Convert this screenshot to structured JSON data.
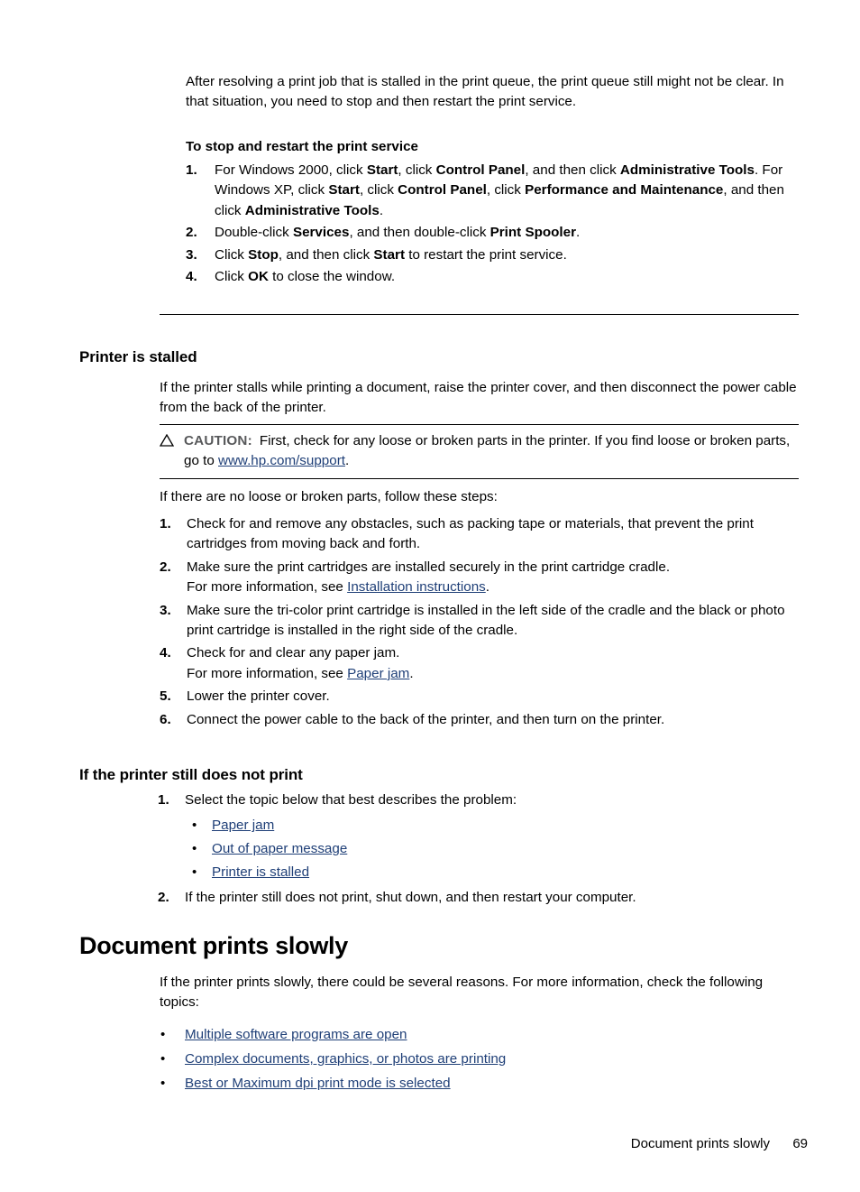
{
  "document": {
    "intro_paragraph": "After resolving a print job that is stalled in the print queue, the print queue still might not be clear. In that situation, you need to stop and then restart the print service.",
    "restart_service": {
      "heading": "To stop and restart the print service",
      "steps": [
        {
          "number": "1.",
          "segments": [
            {
              "text": "For Windows 2000, click ",
              "bold": false
            },
            {
              "text": "Start",
              "bold": true
            },
            {
              "text": ", click ",
              "bold": false
            },
            {
              "text": "Control Panel",
              "bold": true
            },
            {
              "text": ", and then click ",
              "bold": false
            },
            {
              "text": "Administrative Tools",
              "bold": true
            },
            {
              "text": ". For Windows XP, click ",
              "bold": false
            },
            {
              "text": "Start",
              "bold": true
            },
            {
              "text": ", click ",
              "bold": false
            },
            {
              "text": "Control Panel",
              "bold": true
            },
            {
              "text": ", click ",
              "bold": false
            },
            {
              "text": "Performance and Maintenance",
              "bold": true
            },
            {
              "text": ", and then click ",
              "bold": false
            },
            {
              "text": "Administrative Tools",
              "bold": true
            },
            {
              "text": ".",
              "bold": false
            }
          ]
        },
        {
          "number": "2.",
          "segments": [
            {
              "text": "Double-click ",
              "bold": false
            },
            {
              "text": "Services",
              "bold": true
            },
            {
              "text": ", and then double-click ",
              "bold": false
            },
            {
              "text": "Print Spooler",
              "bold": true
            },
            {
              "text": ".",
              "bold": false
            }
          ]
        },
        {
          "number": "3.",
          "segments": [
            {
              "text": "Click ",
              "bold": false
            },
            {
              "text": "Stop",
              "bold": true
            },
            {
              "text": ", and then click ",
              "bold": false
            },
            {
              "text": "Start",
              "bold": true
            },
            {
              "text": " to restart the print service.",
              "bold": false
            }
          ]
        },
        {
          "number": "4.",
          "segments": [
            {
              "text": "Click ",
              "bold": false
            },
            {
              "text": "OK",
              "bold": true
            },
            {
              "text": " to close the window.",
              "bold": false
            }
          ]
        }
      ]
    },
    "printer_stalled": {
      "heading": "Printer is stalled",
      "paragraph": "If the printer stalls while printing a document, raise the printer cover, and then disconnect the power cable from the back of the printer.",
      "caution": {
        "icon": "warning-triangle-icon",
        "label": "CAUTION:",
        "text_before_link": "First, check for any loose or broken parts in the printer. If you find loose or broken parts, go to ",
        "link_text": "www.hp.com/support",
        "text_after_link": "."
      },
      "steps_intro": "If there are no loose or broken parts, follow these steps:",
      "steps": [
        {
          "number": "1.",
          "segments": [
            {
              "text": "Check for and remove any obstacles, such as packing tape or materials, that prevent the print cartridges from moving back and forth.",
              "bold": false
            }
          ]
        },
        {
          "number": "2.",
          "segments": [
            {
              "text": "Make sure the print cartridges are installed securely in the print cartridge cradle.",
              "bold": false
            },
            {
              "text": "\n",
              "linebreak": true
            },
            {
              "text": "For more information, see ",
              "bold": false
            },
            {
              "text": "Installation instructions",
              "link": true
            },
            {
              "text": ".",
              "bold": false
            }
          ]
        },
        {
          "number": "3.",
          "segments": [
            {
              "text": "Make sure the tri-color print cartridge is installed in the left side of the cradle and the black or photo print cartridge is installed in the right side of the cradle.",
              "bold": false
            }
          ]
        },
        {
          "number": "4.",
          "segments": [
            {
              "text": "Check for and clear any paper jam.",
              "bold": false
            },
            {
              "text": "\n",
              "linebreak": true
            },
            {
              "text": "For more information, see ",
              "bold": false
            },
            {
              "text": "Paper jam",
              "link": true
            },
            {
              "text": ".",
              "bold": false
            }
          ]
        },
        {
          "number": "5.",
          "segments": [
            {
              "text": "Lower the printer cover.",
              "bold": false
            }
          ]
        },
        {
          "number": "6.",
          "segments": [
            {
              "text": "Connect the power cable to the back of the printer, and then turn on the printer.",
              "bold": false
            }
          ]
        }
      ]
    },
    "still_not_print": {
      "heading": "If the printer still does not print",
      "step1_number": "1.",
      "step1_text": "Select the topic below that best describes the problem:",
      "bullet_marker": "•",
      "topic_links": [
        "Paper jam",
        "Out of paper message",
        "Printer is stalled"
      ],
      "step2_number": "2.",
      "step2_text": "If the printer still does not print, shut down, and then restart your computer."
    },
    "document_prints_slowly": {
      "heading": "Document prints slowly",
      "paragraph": "If the printer prints slowly, there could be several reasons. For more information, check the following topics:",
      "bullet_marker": "•",
      "topic_links": [
        "Multiple software programs are open",
        "Complex documents, graphics, or photos are printing",
        "Best or Maximum dpi print mode is selected"
      ]
    },
    "footer": {
      "title": "Document prints slowly",
      "page_number": "69"
    },
    "colors": {
      "link": "#1f3f77",
      "caution_label": "#58595b",
      "text": "#000000",
      "rule": "#000000"
    }
  }
}
